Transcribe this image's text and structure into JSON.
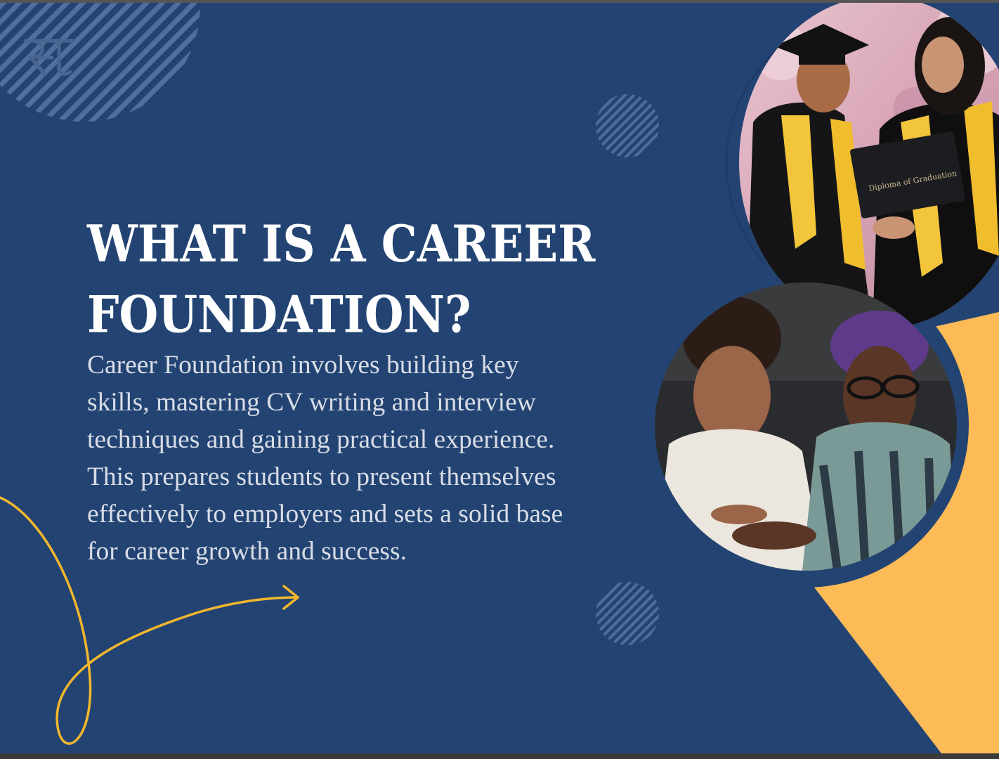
{
  "slide": {
    "title_line1": "WHAT IS A CAREER",
    "title_line2": "FOUNDATION?",
    "body_lines": [
      "Career Foundation involves building key",
      "skills, mastering CV writing and interview",
      "techniques and gaining practical experience.",
      "This prepares students to present themselves",
      "effectively to employers and sets a solid base",
      "for career growth and success."
    ],
    "diploma_text": "Diploma of Graduation"
  },
  "colors": {
    "background": "#234473",
    "accent_yellow": "#fdbb58",
    "curve_yellow": "#f2b72c",
    "text_white": "#ffffff",
    "text_body": "#d9dde6"
  },
  "icons": {
    "logo": "rt-monogram-logo",
    "arrow": "curved-arrow-right-icon"
  }
}
